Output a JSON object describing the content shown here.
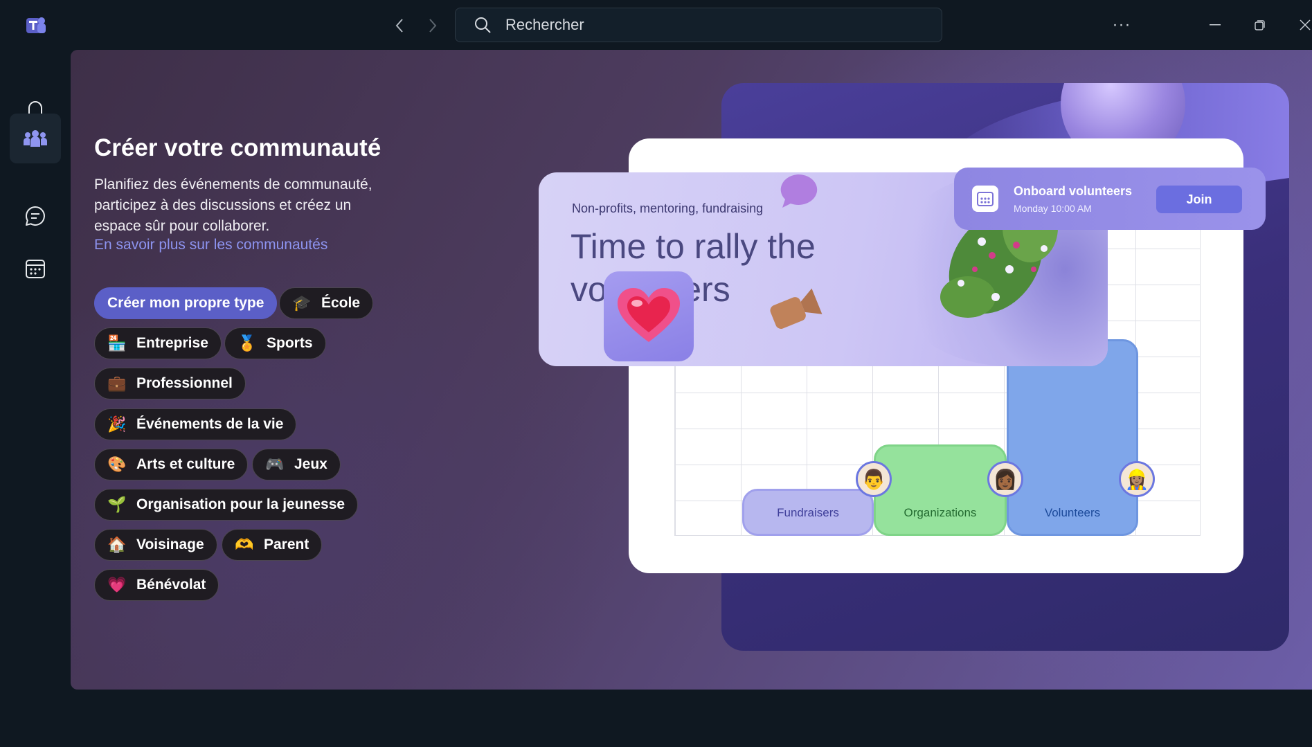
{
  "titlebar": {
    "search_placeholder": "Rechercher",
    "more_label": "···"
  },
  "rail": {
    "items": [
      {
        "name": "activity",
        "icon": "bell-icon"
      },
      {
        "name": "teams",
        "icon": "people-icon",
        "active": true
      },
      {
        "name": "chat",
        "icon": "chat-icon"
      },
      {
        "name": "calendar",
        "icon": "calendar-icon"
      }
    ]
  },
  "main": {
    "heading": "Créer votre communauté",
    "description": "Planifiez des événements de communauté, participez à des discussions et créez un espace sûr pour collaborer.",
    "learn_more": "En savoir plus sur les communautés",
    "chips": [
      {
        "label": "Créer mon propre type",
        "emoji": ""
      },
      {
        "label": "École",
        "emoji": "🎓"
      },
      {
        "label": "Entreprise",
        "emoji": "🏪"
      },
      {
        "label": "Sports",
        "emoji": "🏅"
      },
      {
        "label": "Professionnel",
        "emoji": "💼"
      },
      {
        "label": "Événements de la vie",
        "emoji": "🎉"
      },
      {
        "label": "Arts et culture",
        "emoji": "🎨"
      },
      {
        "label": "Jeux",
        "emoji": "🎮"
      },
      {
        "label": "Organisation pour la jeunesse",
        "emoji": "🌱"
      },
      {
        "label": "Voisinage",
        "emoji": "🏠"
      },
      {
        "label": "Parent",
        "emoji": "🫶"
      },
      {
        "label": "Bénévolat",
        "emoji": "💗"
      }
    ]
  },
  "illustration": {
    "kicker": "Non-profits, mentoring, fundraising",
    "title": "Time to rally the volunteers",
    "event_title": "Onboard volunteers",
    "event_time": "Monday 10:00 AM",
    "join_label": "Join",
    "bars": [
      "Fundraisers",
      "Organizations",
      "Volunteers"
    ]
  },
  "colors": {
    "accent": "#5b5fc7",
    "link": "#8d93ef",
    "background": "#0f1821"
  }
}
